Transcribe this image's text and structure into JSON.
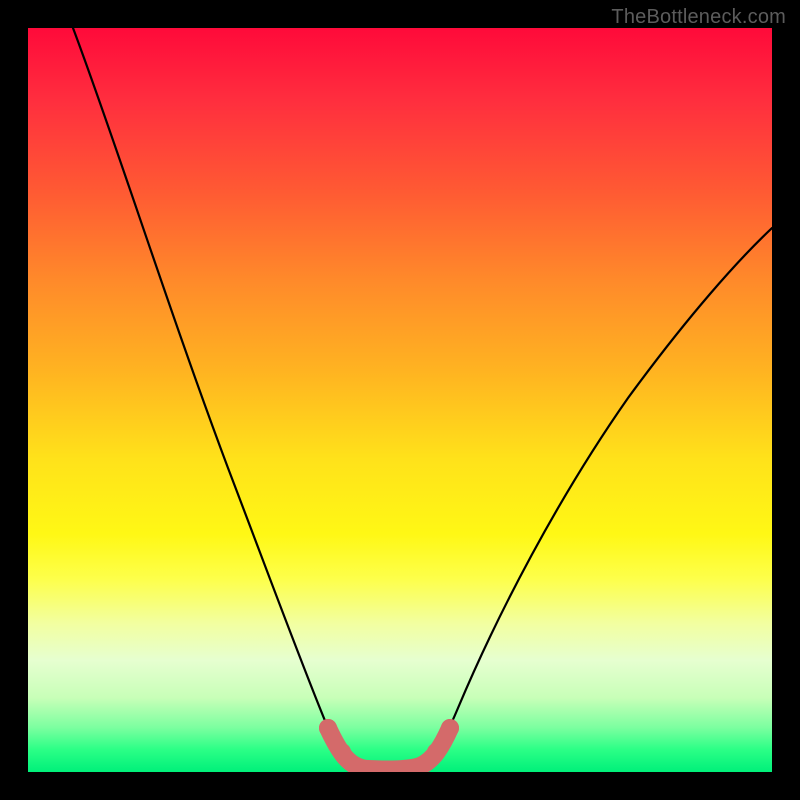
{
  "watermark": "TheBottleneck.com",
  "colors": {
    "frame": "#000000",
    "curve": "#000000",
    "highlight": "#d46a6a",
    "watermark": "#5c5c5c"
  },
  "chart_data": {
    "type": "line",
    "title": "",
    "xlabel": "",
    "ylabel": "",
    "xlim": [
      0,
      100
    ],
    "ylim": [
      0,
      100
    ],
    "grid": false,
    "legend": false,
    "series": [
      {
        "name": "bottleneck-curve",
        "x": [
          6,
          10,
          15,
          20,
          25,
          30,
          34,
          37,
          40,
          43,
          46,
          49,
          52,
          55,
          60,
          65,
          70,
          75,
          80,
          85,
          90,
          95,
          100
        ],
        "y": [
          100,
          90,
          78,
          65,
          52,
          38,
          25,
          14,
          6,
          1,
          0,
          0,
          1,
          5,
          13,
          22,
          30,
          37,
          44,
          50,
          55,
          60,
          64
        ]
      }
    ],
    "highlight_segment": {
      "series": "bottleneck-curve",
      "x_range": [
        40,
        53
      ],
      "note": "bottom of curve, thick stroke"
    },
    "background_gradient": {
      "direction": "vertical",
      "stops": [
        {
          "pos": 0.0,
          "color": "#ff0a3a"
        },
        {
          "pos": 0.5,
          "color": "#ffd31a"
        },
        {
          "pos": 0.8,
          "color": "#f5ff9c"
        },
        {
          "pos": 1.0,
          "color": "#00f07a"
        }
      ]
    }
  }
}
